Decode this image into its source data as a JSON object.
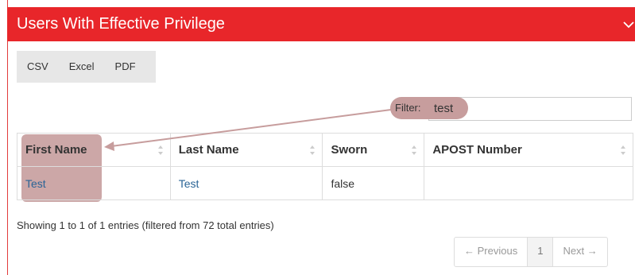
{
  "panel": {
    "title": "Users With Effective Privilege"
  },
  "toolbar": {
    "buttons": [
      "CSV",
      "Excel",
      "PDF"
    ]
  },
  "filter": {
    "label": "Filter:",
    "value": "test"
  },
  "table": {
    "columns": [
      "First Name",
      "Last Name",
      "Sworn",
      "APOST Number"
    ],
    "rows": [
      [
        "Test",
        "Test",
        "false",
        ""
      ]
    ]
  },
  "info": "Showing 1 to 1 of 1 entries (filtered from 72 total entries)",
  "pager": {
    "previous": "← Previous",
    "page": "1",
    "next": "Next →"
  },
  "colors": {
    "header_bg": "#e8262a",
    "annotation": "#c79d9d",
    "link": "#2a6496"
  },
  "icons": [
    "chevron-down-icon",
    "sort-icon"
  ]
}
